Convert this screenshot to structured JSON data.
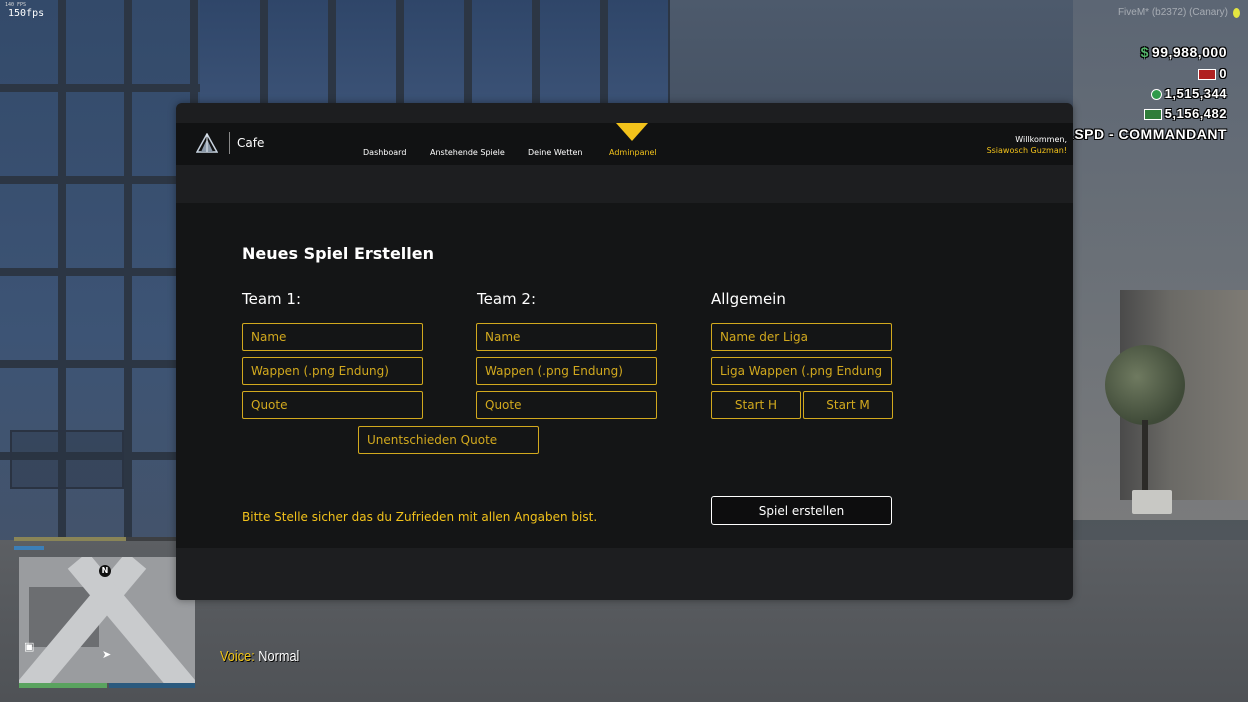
{
  "hud": {
    "fps_small": "140 FPS",
    "fps": "150fps",
    "fivem": "FiveM* (b2372) (Canary)",
    "cash": "99,988,000",
    "dirty": "0",
    "bank": "1,515,344",
    "black": "5,156,482",
    "job": "LSPD - COMMANDANT",
    "voice_label": "Voice:",
    "voice_value": "Normal",
    "compass": "N"
  },
  "panel": {
    "brand": "Cafe",
    "nav": {
      "dashboard": "Dashboard",
      "spiele": "Anstehende Spiele",
      "wetten": "Deine Wetten",
      "admin": "Adminpanel"
    },
    "welcome_line1": "Willkommen,",
    "welcome_user": "Ssiawosch Guzman!"
  },
  "form": {
    "title": "Neues Spiel Erstellen",
    "team1": {
      "heading": "Team 1:",
      "name_placeholder": "Name",
      "wappen_placeholder": "Wappen (.png Endung)",
      "quote_placeholder": "Quote"
    },
    "team2": {
      "heading": "Team 2:",
      "name_placeholder": "Name",
      "wappen_placeholder": "Wappen (.png Endung)",
      "quote_placeholder": "Quote"
    },
    "draw_placeholder": "Unentschieden Quote",
    "general": {
      "heading": "Allgemein",
      "liga_placeholder": "Name der Liga",
      "liga_wappen_placeholder": "Liga Wappen (.png Endung)",
      "start_h_placeholder": "Start H",
      "start_m_placeholder": "Start M"
    },
    "hint": "Bitte Stelle sicher das du Zufrieden mit allen Angaben bist.",
    "submit_label": "Spiel erstellen"
  },
  "colors": {
    "accent": "#f2c21b",
    "input_border": "#d2a91e"
  }
}
